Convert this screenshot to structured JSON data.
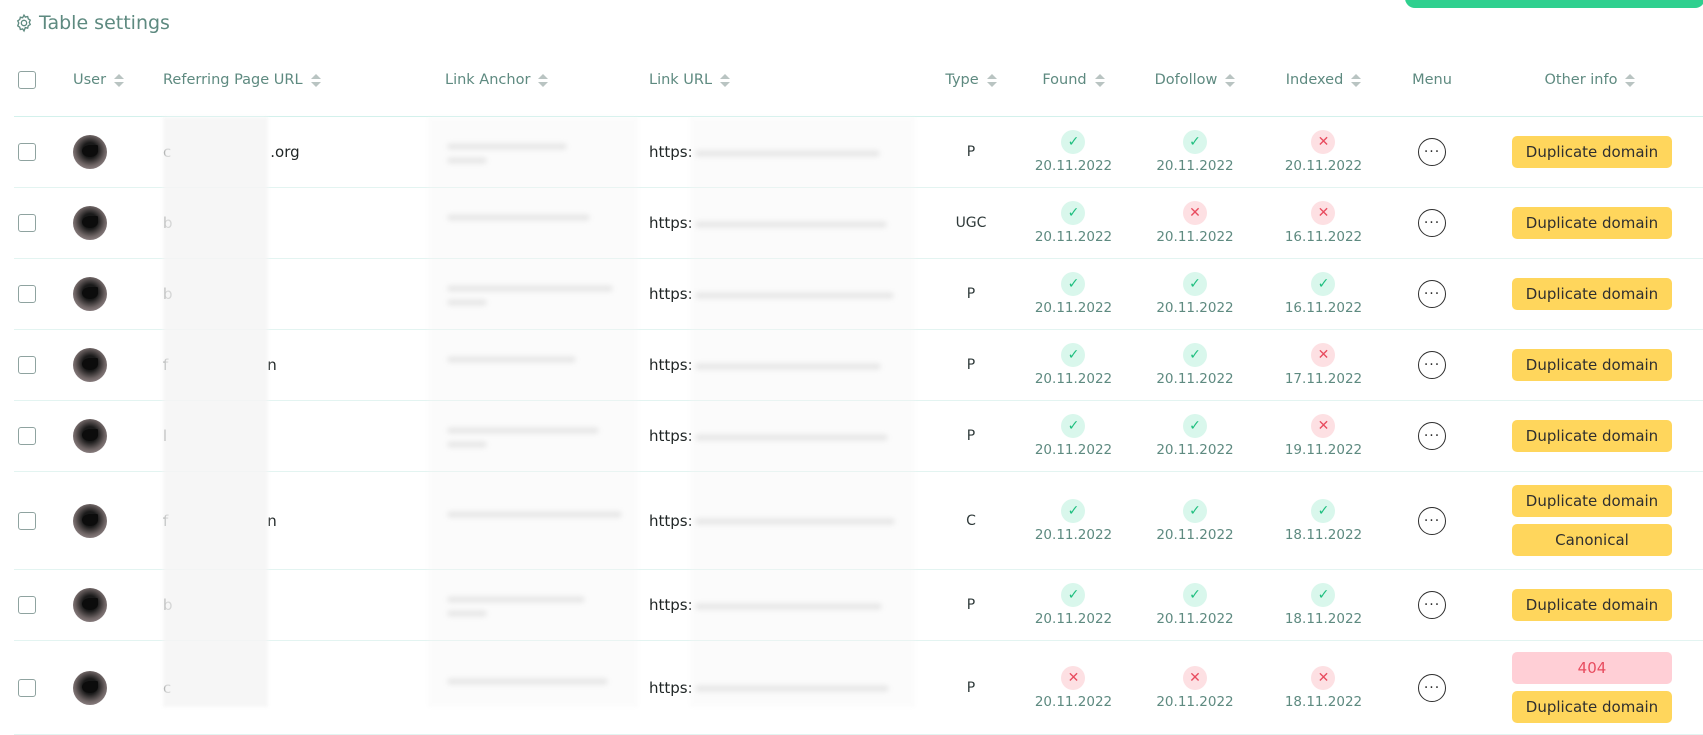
{
  "title": "Table settings",
  "columns": {
    "user": "User",
    "referring": "Referring Page URL",
    "anchor": "Link Anchor",
    "link_url": "Link URL",
    "type": "Type",
    "found": "Found",
    "dofollow": "Dofollow",
    "indexed": "Indexed",
    "menu": "Menu",
    "other": "Other info"
  },
  "rows": [
    {
      "ref": "c",
      "ref_suffix": ".org",
      "link": "https:",
      "type": "P",
      "found": {
        "ok": true,
        "date": "20.11.2022"
      },
      "dofollow": {
        "ok": true,
        "date": "20.11.2022"
      },
      "indexed": {
        "ok": false,
        "date": "20.11.2022"
      },
      "tags": [
        {
          "label": "Duplicate domain",
          "color": "#ffd65c"
        }
      ]
    },
    {
      "ref": "b",
      "ref_suffix": "",
      "link": "https:",
      "type": "UGC",
      "found": {
        "ok": true,
        "date": "20.11.2022"
      },
      "dofollow": {
        "ok": false,
        "date": "20.11.2022"
      },
      "indexed": {
        "ok": false,
        "date": "16.11.2022"
      },
      "tags": [
        {
          "label": "Duplicate domain",
          "color": "#ffd65c"
        }
      ]
    },
    {
      "ref": "b",
      "ref_suffix": "",
      "link": "https:",
      "type": "P",
      "found": {
        "ok": true,
        "date": "20.11.2022"
      },
      "dofollow": {
        "ok": true,
        "date": "20.11.2022"
      },
      "indexed": {
        "ok": true,
        "date": "16.11.2022"
      },
      "tags": [
        {
          "label": "Duplicate domain",
          "color": "#ffd65c"
        }
      ]
    },
    {
      "ref": "f",
      "ref_suffix": "n",
      "link": "https:",
      "type": "P",
      "found": {
        "ok": true,
        "date": "20.11.2022"
      },
      "dofollow": {
        "ok": true,
        "date": "20.11.2022"
      },
      "indexed": {
        "ok": false,
        "date": "17.11.2022"
      },
      "tags": [
        {
          "label": "Duplicate domain",
          "color": "#ffd65c"
        }
      ]
    },
    {
      "ref": "l",
      "ref_suffix": "",
      "link": "https:",
      "type": "P",
      "found": {
        "ok": true,
        "date": "20.11.2022"
      },
      "dofollow": {
        "ok": true,
        "date": "20.11.2022"
      },
      "indexed": {
        "ok": false,
        "date": "19.11.2022"
      },
      "tags": [
        {
          "label": "Duplicate domain",
          "color": "#ffd65c"
        }
      ]
    },
    {
      "ref": "f",
      "ref_suffix": "n",
      "link": "https:",
      "type": "C",
      "found": {
        "ok": true,
        "date": "20.11.2022"
      },
      "dofollow": {
        "ok": true,
        "date": "20.11.2022"
      },
      "indexed": {
        "ok": true,
        "date": "18.11.2022"
      },
      "tags": [
        {
          "label": "Duplicate domain",
          "color": "#ffd65c"
        },
        {
          "label": "Canonical",
          "color": "#ffd65c"
        }
      ]
    },
    {
      "ref": "b",
      "ref_suffix": "",
      "link": "https:",
      "type": "P",
      "found": {
        "ok": true,
        "date": "20.11.2022"
      },
      "dofollow": {
        "ok": true,
        "date": "20.11.2022"
      },
      "indexed": {
        "ok": true,
        "date": "18.11.2022"
      },
      "tags": [
        {
          "label": "Duplicate domain",
          "color": "#ffd65c"
        }
      ]
    },
    {
      "ref": "c",
      "ref_suffix": "",
      "link": "https:",
      "type": "P",
      "found": {
        "ok": false,
        "date": "20.11.2022"
      },
      "dofollow": {
        "ok": false,
        "date": "20.11.2022"
      },
      "indexed": {
        "ok": false,
        "date": "18.11.2022"
      },
      "tags": [
        {
          "label": "404",
          "color": "#ffcfd6"
        },
        {
          "label": "Duplicate domain",
          "color": "#ffd65c"
        }
      ]
    }
  ],
  "icons": {
    "ok": "check-icon",
    "no": "cross-icon",
    "menu": "more-horizontal-icon",
    "settings": "gear-icon"
  },
  "colors": {
    "accent": "#2fd08f",
    "ok": "#1fbf7f",
    "no": "#e84c5f",
    "tag_yellow": "#ffd65c",
    "tag_pink": "#ffcfd6"
  }
}
